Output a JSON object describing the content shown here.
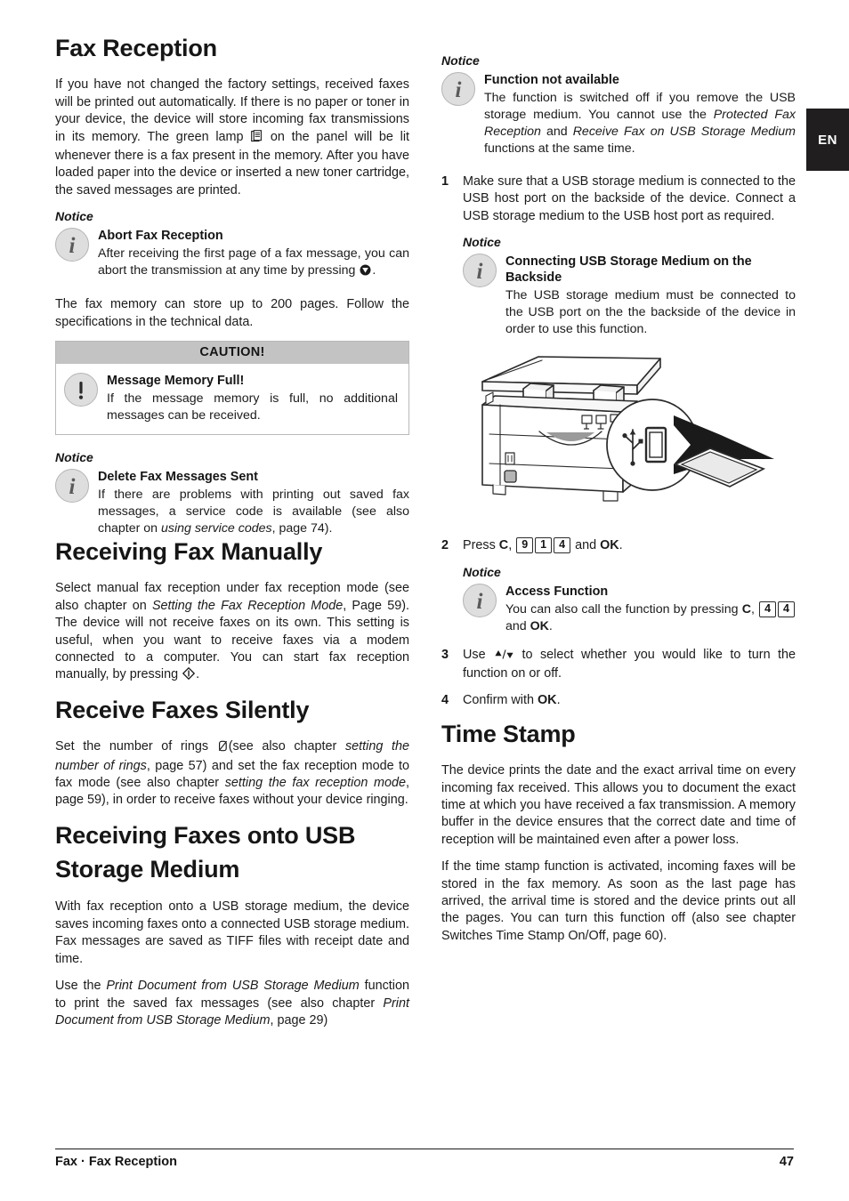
{
  "language_tab": "EN",
  "left_column": {
    "heading_fax_reception": "Fax Reception",
    "intro_paragraph_1": "If you have not changed the factory settings, received faxes will be printed out automatically. If there is no paper or toner in your device, the device will store incoming fax transmissions in its memory. The green lamp",
    "intro_paragraph_2": "on the panel will be lit whenever there is a fax present in the memory.  After you have loaded paper into the device or inserted a new toner cartridge, the saved messages are printed.",
    "notice_label_1": "Notice",
    "notice_abort_title": "Abort Fax Reception",
    "notice_abort_text_1": "After receiving the first page of a fax message, you can abort the transmission at any time by pressing",
    "notice_abort_text_2": ".",
    "memory_paragraph": "The fax memory can store up to 200 pages. Follow the specifications in the technical data.",
    "caution_header": "CAUTION!",
    "caution_title": "Message Memory Full!",
    "caution_text": "If the message memory is full, no additional messages can be received.",
    "notice_label_2": "Notice",
    "notice_delete_title": "Delete Fax Messages Sent",
    "notice_delete_text_1": "If there are problems with printing out saved fax messages, a service code is available (see also chapter on",
    "notice_delete_italic": "using service codes",
    "notice_delete_text_2": ", page  74).",
    "heading_receiving_manually": "Receiving Fax Manually",
    "manual_text_1": "Select manual fax reception under fax reception mode (see also chapter on",
    "manual_italic_1": "Setting the Fax Reception Mode",
    "manual_text_2": ", Page 59). The device will not receive faxes on its own. This setting is useful, when you want to receive faxes via a modem connected to a computer. You can start fax reception manually, by pressing",
    "manual_text_3": ".",
    "heading_silently": "Receive Faxes Silently",
    "silent_text_1": "Set the number of rings",
    "silent_text_2": "(see also chapter ",
    "silent_italic_1": "setting the number of rings",
    "silent_text_3": ", page    57) and set the fax reception mode to fax mode (see also chapter ",
    "silent_italic_2": "setting the fax reception mode",
    "silent_text_4": ", page  59),  in order to receive faxes without your device ringing.",
    "heading_usb": "Receiving Faxes onto USB Storage Medium",
    "usb_paragraph_1": "With fax reception onto a USB storage medium, the device saves incoming faxes onto a connected USB storage medium. Fax messages are saved as TIFF files with receipt date and time.",
    "usb_paragraph_2_a": "Use the",
    "usb_paragraph_2_italic_1": "Print Document from USB Storage Medium",
    "usb_paragraph_2_b": "function to print the saved fax messages (see also chapter",
    "usb_paragraph_2_italic_2": "Print Document from USB Storage Medium",
    "usb_paragraph_2_c": ", page 29)"
  },
  "right_column": {
    "notice_label_1": "Notice",
    "notice_function_title": "Function not available",
    "notice_function_text_1": "The function is switched off if you remove the USB storage medium. You cannot use the",
    "notice_function_italic_1": "Protected Fax Reception",
    "notice_function_text_2": "and",
    "notice_function_italic_2": "Receive Fax on USB Storage Medium",
    "notice_function_text_3": "functions at the same time.",
    "step_1_num": "1",
    "step_1_text": "Make sure that a USB storage medium is connected to the USB host port on the backside of the device. Connect a USB storage medium to the USB host port as required.",
    "notice_label_2": "Notice",
    "notice_connecting_title": "Connecting USB Storage Medium on the Backside",
    "notice_connecting_text": "The USB storage medium must be connected to the USB port on the the backside of the device in order to use this function.",
    "figure_name": "device-backside-usb-illustration",
    "step_2_num": "2",
    "step_2_text_a": "Press",
    "step_2_key_c": "C",
    "step_2_comma": ",",
    "step_2_keys": [
      "9",
      "1",
      "4"
    ],
    "step_2_text_b": "and",
    "step_2_key_ok": "OK",
    "step_2_period": ".",
    "notice_label_3": "Notice",
    "notice_access_title": "Access Function",
    "notice_access_text_a": "You can also call the function by pressing",
    "notice_access_key_c": "C",
    "notice_access_comma": ",",
    "notice_access_keys": [
      "4",
      "4"
    ],
    "notice_access_text_b": "and",
    "notice_access_key_ok": "OK",
    "notice_access_period": ".",
    "step_3_num": "3",
    "step_3_text_a": "Use",
    "step_3_text_b": "to select whether you would like to turn the function on or off.",
    "step_4_num": "4",
    "step_4_text_a": "Confirm with",
    "step_4_key_ok": "OK",
    "step_4_period": ".",
    "heading_time_stamp": "Time Stamp",
    "time_paragraph_1": "The device prints the date and the exact arrival time on every incoming fax received. This allows you to document the exact time at which you have received a fax transmission. A memory buffer in the device ensures that the correct date and time of reception will be maintained even after a power loss.",
    "time_paragraph_2": "If the time stamp function is activated, incoming faxes will be stored in the fax memory. As soon as the last page has arrived, the arrival time is stored and the device prints out all the pages. You can turn this function off (also see chapter Switches Time Stamp On/Off, page 60)."
  },
  "footer": {
    "left": "Fax · Fax Reception",
    "page_number": "47"
  },
  "colors": {
    "text": "#1a1a1a",
    "caution_header_bg": "#c3c3c3",
    "badge_bg": "#dedede",
    "tab_bg": "#201e1e"
  }
}
